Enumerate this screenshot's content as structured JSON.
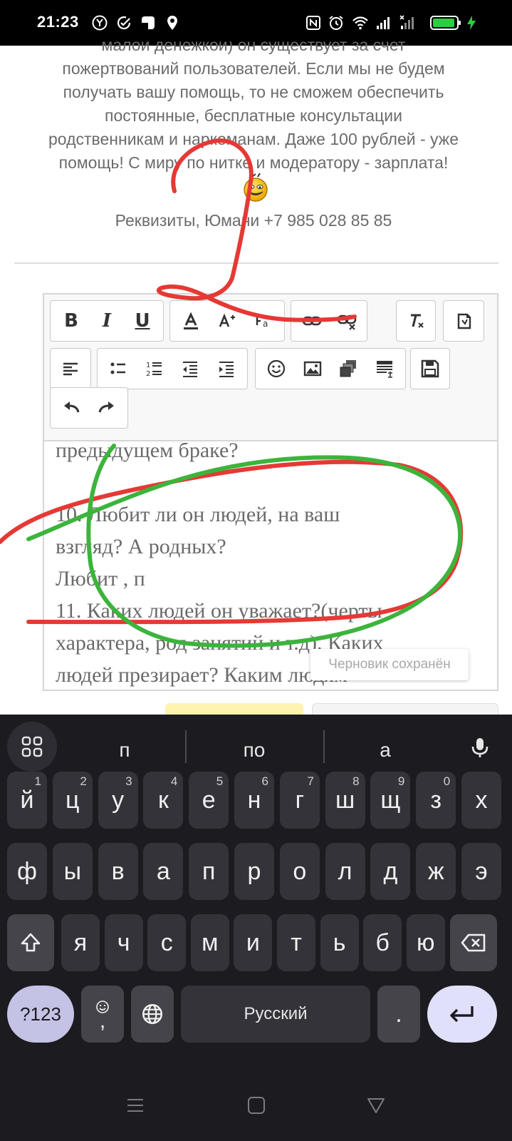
{
  "status_bar": {
    "time": "21:23",
    "icons": [
      "y-circle-icon",
      "check-circle-icon",
      "app-icon",
      "location-icon",
      "nfc-icon",
      "alarm-icon",
      "wifi-icon",
      "signal-icon",
      "signal-x-icon",
      "battery-icon",
      "charging-icon"
    ]
  },
  "page": {
    "donation_line0": "малой денежкой) он существует за счет",
    "donation_line1": "пожертвований пользователей. Если мы не будем",
    "donation_line2": "получать вашу помощь, то не сможем обеспечить",
    "donation_line3": "постоянные, бесплатные консультации",
    "donation_line4": "родственникам и наркоманам. Даже 100 рублей - уже",
    "donation_line5": "помощь! С миру по нитке и модератору - зарплата!",
    "requisites": "Реквизиты, Юмани +7 985 028 85 85"
  },
  "editor": {
    "toolbar": {
      "bold": "B",
      "italic": "I",
      "underline": "U"
    },
    "lines": [
      "предыдущем браке?",
      "",
      "10. Любит ли он людей, на ваш",
      "взгляд? А родных?",
      "Любит , п",
      "11. Каких людей он уважает?(черты",
      "характера, род занятий и т.д). Каких",
      "людей презирает? Каким людям"
    ],
    "toast": "Черновик сохранён"
  },
  "keyboard": {
    "suggestions": [
      "п",
      "по",
      "а"
    ],
    "row1": [
      "й",
      "ц",
      "у",
      "к",
      "е",
      "н",
      "г",
      "ш",
      "щ",
      "з",
      "х"
    ],
    "row1_hints": [
      "1",
      "2",
      "3",
      "4",
      "5",
      "6",
      "7",
      "8",
      "9",
      "0",
      ""
    ],
    "row2": [
      "ф",
      "ы",
      "в",
      "а",
      "п",
      "р",
      "о",
      "л",
      "д",
      "ж",
      "э"
    ],
    "row3": [
      "я",
      "ч",
      "с",
      "м",
      "и",
      "т",
      "ь",
      "б",
      "ю"
    ],
    "symbols": "?123",
    "comma": ",",
    "space": "Русский",
    "period": ".",
    "accent_colors": {
      "enter": "#e1e0fa",
      "symbols": "#c4c2e5",
      "keys": "#343339",
      "background": "#1c1b20"
    }
  },
  "annotation_colors": {
    "red": "#e53935",
    "green": "#3cb43c"
  }
}
